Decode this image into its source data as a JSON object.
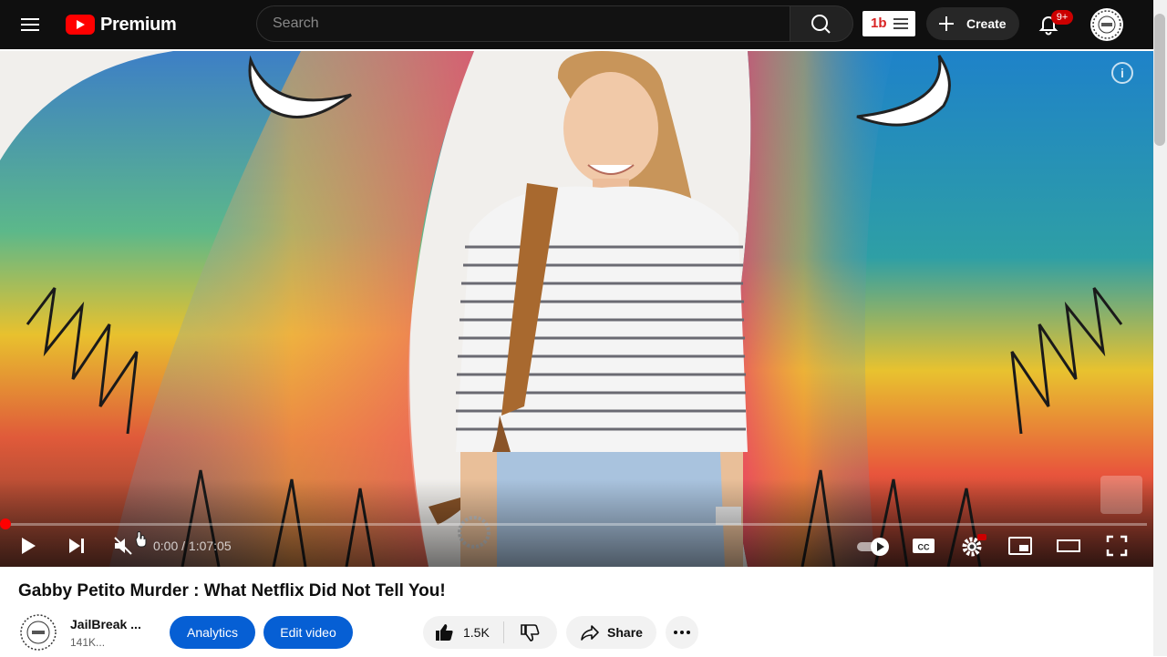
{
  "header": {
    "logo_text": "Premium",
    "search_placeholder": "Search",
    "create_label": "Create",
    "notification_count": "9+",
    "extension_label": "1b"
  },
  "player": {
    "current_time": "0:00",
    "time_separator": "/",
    "duration": "1:07:05",
    "info_label": "i",
    "progress_fraction": 0,
    "muted": true
  },
  "video": {
    "title": "Gabby Petito Murder : What Netflix Did Not Tell You!",
    "channel_name": "JailBreak ...",
    "subscribers": "141K...",
    "analytics_label": "Analytics",
    "edit_label": "Edit video",
    "like_count": "1.5K",
    "share_label": "Share"
  },
  "colors": {
    "accent_blue": "#065fd4",
    "youtube_red": "#ff0000",
    "topbar_bg": "#0f0f0f"
  }
}
